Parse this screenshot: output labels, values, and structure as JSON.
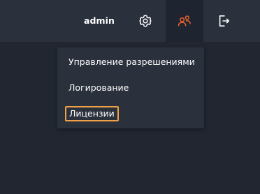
{
  "header": {
    "username": "admin",
    "icons": {
      "settings": "gear-icon",
      "users": "users-icon",
      "logout": "logout-icon"
    }
  },
  "dropdown": {
    "items": [
      {
        "label": "Управление разрешениями"
      },
      {
        "label": "Логирование"
      },
      {
        "label": "Лицензии",
        "highlighted": true
      }
    ]
  },
  "colors": {
    "background": "#212630",
    "topbar": "#2a303c",
    "accent": "#e8622c",
    "highlight_border": "#f0a045",
    "text": "#ffffff"
  }
}
